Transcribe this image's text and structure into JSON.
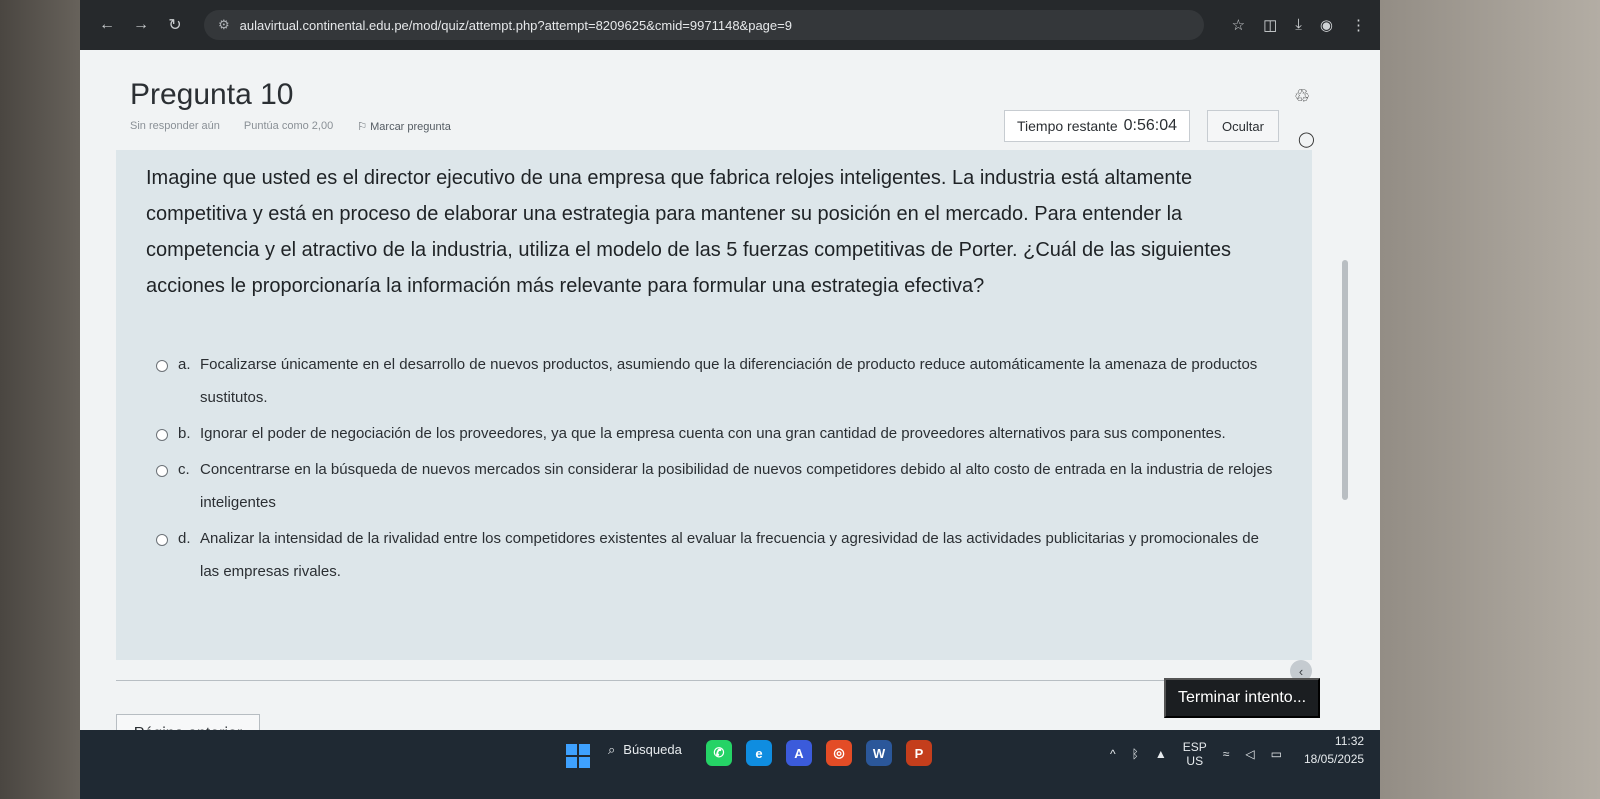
{
  "browser": {
    "url": "aulavirtual.continental.edu.pe/mod/quiz/attempt.php?attempt=8209625&cmid=9971148&page=9",
    "icons": [
      "back-icon",
      "forward-icon",
      "reload-icon",
      "site-info-icon",
      "star-icon",
      "extensions-icon",
      "download-icon",
      "profile-icon",
      "menu-icon"
    ]
  },
  "question": {
    "title": "Pregunta 10",
    "status": "Sin responder aún",
    "points": "Puntúa como 2,00",
    "flag_label": "Marcar pregunta",
    "text": "Imagine que usted es el director ejecutivo de una empresa que fabrica relojes inteligentes. La industria está altamente competitiva y está en proceso de elaborar una estrategia para mantener su posición en el mercado. Para entender la competencia y el atractivo de la industria, utiliza el modelo de las 5 fuerzas competitivas de Porter. ¿Cuál de las siguientes acciones le proporcionaría la información más relevante para formular una estrategia efectiva?",
    "options": [
      {
        "letter": "a.",
        "text": "Focalizarse únicamente en el desarrollo de nuevos productos, asumiendo que la diferenciación de producto reduce automáticamente la amenaza de productos sustitutos."
      },
      {
        "letter": "b.",
        "text": "Ignorar el poder de negociación de los proveedores, ya que la empresa cuenta con una gran cantidad de proveedores alternativos para sus componentes."
      },
      {
        "letter": "c.",
        "text": "Concentrarse en la búsqueda de nuevos mercados sin considerar la posibilidad de nuevos competidores debido al alto costo de entrada en la industria de relojes inteligentes"
      },
      {
        "letter": "d.",
        "text": "Analizar la intensidad de la rivalidad entre los competidores existentes al evaluar la frecuencia y agresividad de las actividades publicitarias y promocionales de las empresas rivales."
      }
    ]
  },
  "timer": {
    "label": "Tiempo restante",
    "value": "0:56:04",
    "hide_label": "Ocultar"
  },
  "nav": {
    "finish_label": "Terminar intento...",
    "prev_label": "Página anterior"
  },
  "taskbar": {
    "search_label": "Búsqueda",
    "lang_top": "ESP",
    "lang_bottom": "US",
    "time": "11:32",
    "date": "18/05/2025"
  }
}
